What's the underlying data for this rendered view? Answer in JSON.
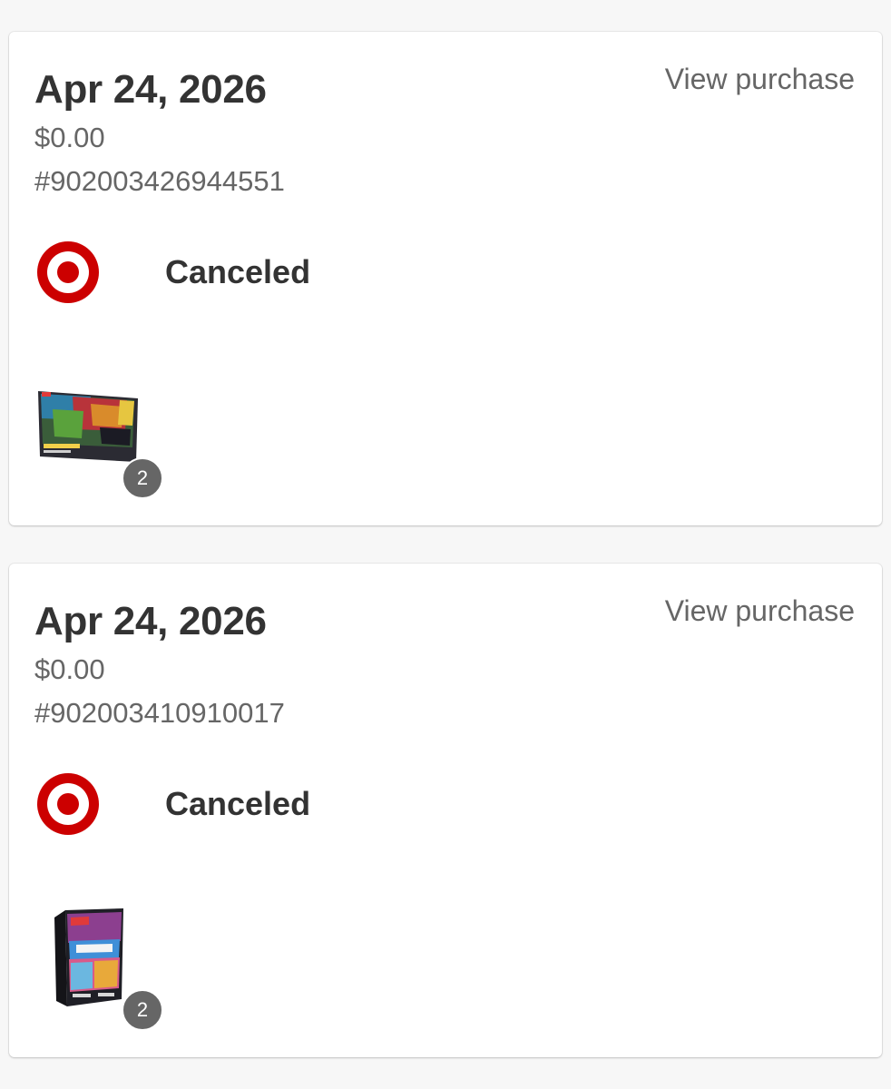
{
  "colors": {
    "page_background": "#f7f7f7",
    "card_background": "#ffffff",
    "primary_text": "#333333",
    "secondary_text": "#666666",
    "target_red": "#cc0000",
    "badge_background": "#666666"
  },
  "orders": [
    {
      "date": "Apr 24, 2026",
      "view_label": "View purchase",
      "total": "$0.00",
      "order_number": "#902003426944551",
      "store_icon": "target-bullseye-icon",
      "status": "Canceled",
      "item_image": "pokemon-mega-zygarde-box-thumbnail",
      "item_quantity": "2"
    },
    {
      "date": "Apr 24, 2026",
      "view_label": "View purchase",
      "total": "$0.00",
      "order_number": "#902003410910017",
      "store_icon": "target-bullseye-icon",
      "status": "Canceled",
      "item_image": "pokemon-booster-bundle-thumbnail",
      "item_quantity": "2"
    }
  ]
}
